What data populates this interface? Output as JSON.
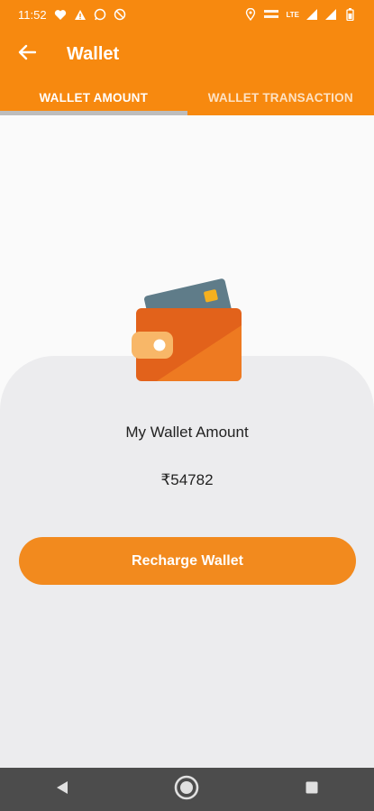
{
  "status_bar": {
    "time": "11:52",
    "left_icons": [
      "heart-icon",
      "warning-icon",
      "whatsapp-icon",
      "blocked-icon"
    ],
    "right_icons": [
      "location-icon",
      "volte-icon",
      "signal-icon",
      "battery-icon"
    ],
    "volte_label_top": "Vo)) LTE",
    "network": "LTE"
  },
  "app_bar": {
    "title": "Wallet",
    "back_icon": "arrow-left-icon"
  },
  "tabs": [
    {
      "label": "WALLET AMOUNT",
      "selected": true
    },
    {
      "label": "WALLET TRANSACTION",
      "selected": false
    }
  ],
  "wallet": {
    "label": "My Wallet Amount",
    "amount": "₹54782",
    "recharge_label": "Recharge Wallet"
  },
  "colors": {
    "primary": "#f7890f",
    "button": "#f28a1e",
    "card_bg": "#ececee",
    "nav_bg": "#4c4c4c"
  },
  "nav_bar": {
    "icons": [
      "back-triangle-icon",
      "home-circle-icon",
      "recents-square-icon"
    ]
  }
}
